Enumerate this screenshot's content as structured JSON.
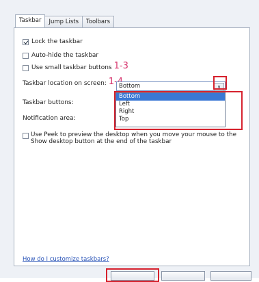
{
  "tabs": [
    {
      "label": "Taskbar",
      "active": true
    },
    {
      "label": "Jump Lists",
      "active": false
    },
    {
      "label": "Toolbars",
      "active": false
    }
  ],
  "options": {
    "lock": {
      "label": "Lock the taskbar",
      "checked": true
    },
    "autohide": {
      "label": "Auto-hide the taskbar",
      "checked": false
    },
    "small_buttons": {
      "label": "Use small taskbar buttons",
      "checked": false
    },
    "peek": {
      "label": "Use Peek to preview the desktop when you move your mouse to the Show desktop button at the end of the taskbar",
      "checked": false
    }
  },
  "annotations": {
    "a13": "1-3",
    "a14": "1-4"
  },
  "location": {
    "label": "Taskbar location on screen:",
    "selected": "Bottom",
    "items": [
      "Bottom",
      "Left",
      "Right",
      "Top"
    ]
  },
  "taskbar_buttons_label": "Taskbar buttons:",
  "notification_label": "Notification area:",
  "help_link": "How do I customize taskbars?",
  "colors": {
    "highlight": "#3a78d4",
    "annotation": "#d6306a",
    "callout": "#d6222e"
  },
  "icons": {
    "dropdown_arrow": "chevron-down-icon",
    "checkmark": "check-icon"
  }
}
